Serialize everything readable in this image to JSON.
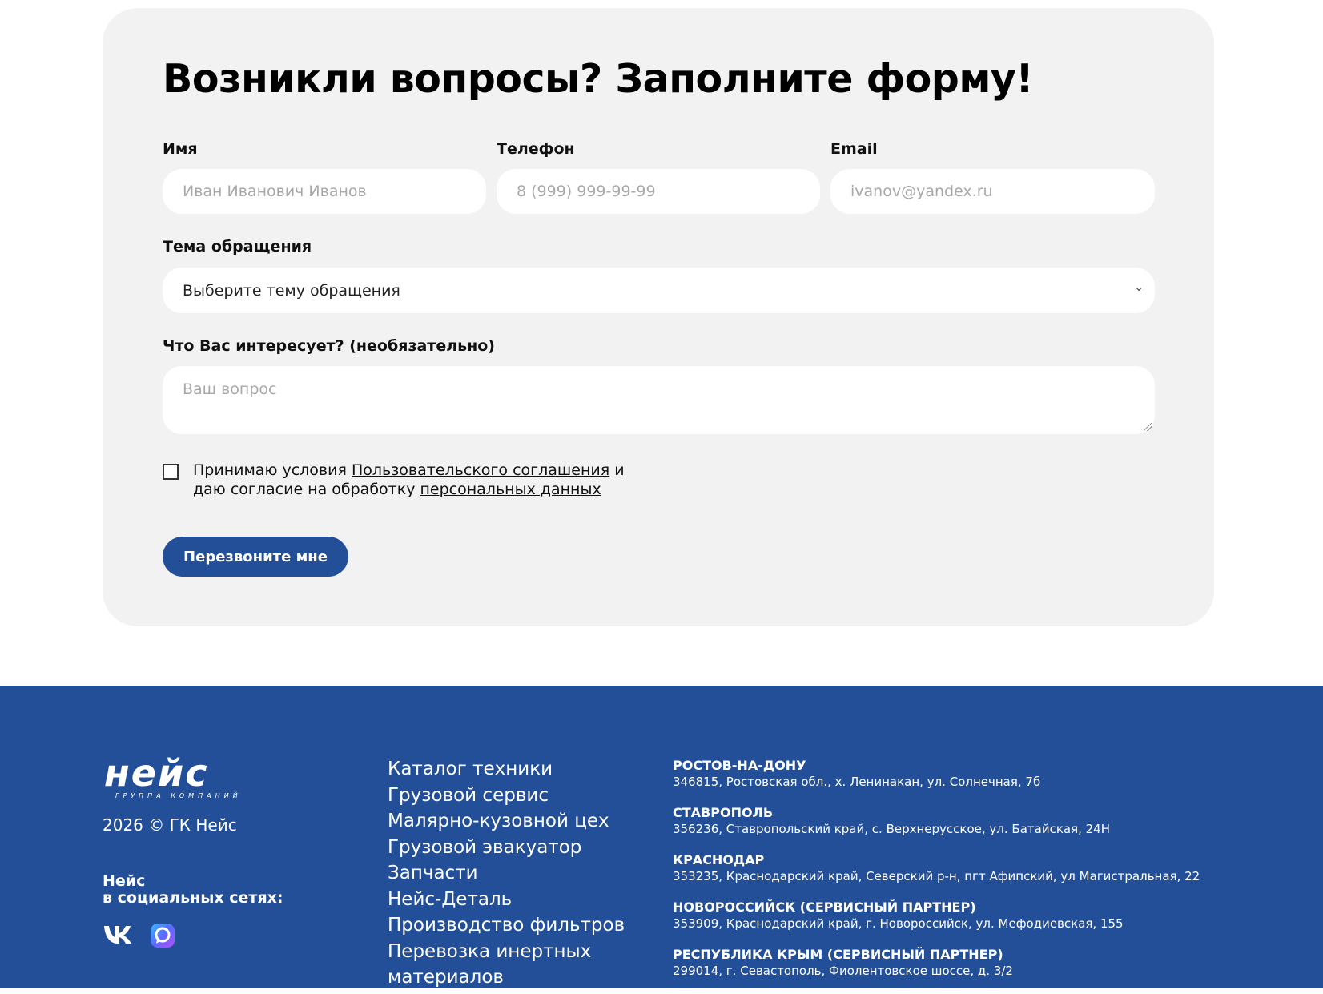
{
  "form": {
    "title": "Возникли вопросы? Заполните форму!",
    "name_label": "Имя",
    "name_placeholder": "Иван Иванович Иванов",
    "phone_label": "Телефон",
    "phone_placeholder": "8 (999) 999-99-99",
    "email_label": "Email",
    "email_placeholder": "ivanov@yandex.ru",
    "topic_label": "Тема обращения",
    "topic_selected": "Выберите тему обращения",
    "question_label": "Что Вас интересует? (необязательно)",
    "question_placeholder": "Ваш вопрос",
    "consent_prefix": "Принимаю условия ",
    "consent_link1": "Пользовательского соглашения",
    "consent_middle": " и даю согласие на обработку ",
    "consent_link2": "персональных данных",
    "submit_label": "Перезвоните мне"
  },
  "footer": {
    "logo_text": "нейс",
    "logo_subtitle": "ГРУППА КОМПАНИЙ",
    "copyright": "2026 © ГК Нейс",
    "social_title_line1": "Нейс",
    "social_title_line2": "в социальных сетях:",
    "nav": [
      "Каталог техники",
      "Грузовой сервис",
      "Малярно-кузовной цех",
      "Грузовой эвакуатор",
      "Запчасти",
      "Нейс-Деталь",
      "Производство фильтров",
      "Перевозка инертных материалов"
    ],
    "offices": [
      {
        "city": "РОСТОВ-НА-ДОНУ",
        "address": "346815, Ростовская обл., х. Ленинакан, ул. Солнечная, 7б"
      },
      {
        "city": "СТАВРОПОЛЬ",
        "address": "356236, Ставропольский край, с. Верхнерусское, ул. Батайская, 24Н"
      },
      {
        "city": "КРАСНОДАР",
        "address": "353235, Краснодарский край, Северский р-н, пгт Афипский, ул Магистральная, 22"
      },
      {
        "city": "НОВОРОССИЙСК (СЕРВИСНЫЙ ПАРТНЕР)",
        "address": "353909, Краснодарский край, г. Новороссийск, ул. Мефодиевская, 155"
      },
      {
        "city": "РЕСПУБЛИКА КРЫМ (СЕРВИСНЫЙ ПАРТНЕР)",
        "address": "299014, г. Севастополь, Фиолентовское шоссе, д. 3/2"
      }
    ]
  },
  "colors": {
    "brand_blue": "#234f98",
    "card_bg": "#f2f2f2",
    "placeholder": "#a8a8a8"
  },
  "icons": {
    "social": [
      "vk-icon",
      "max-messenger-icon"
    ],
    "select": "chevron-down-icon"
  }
}
